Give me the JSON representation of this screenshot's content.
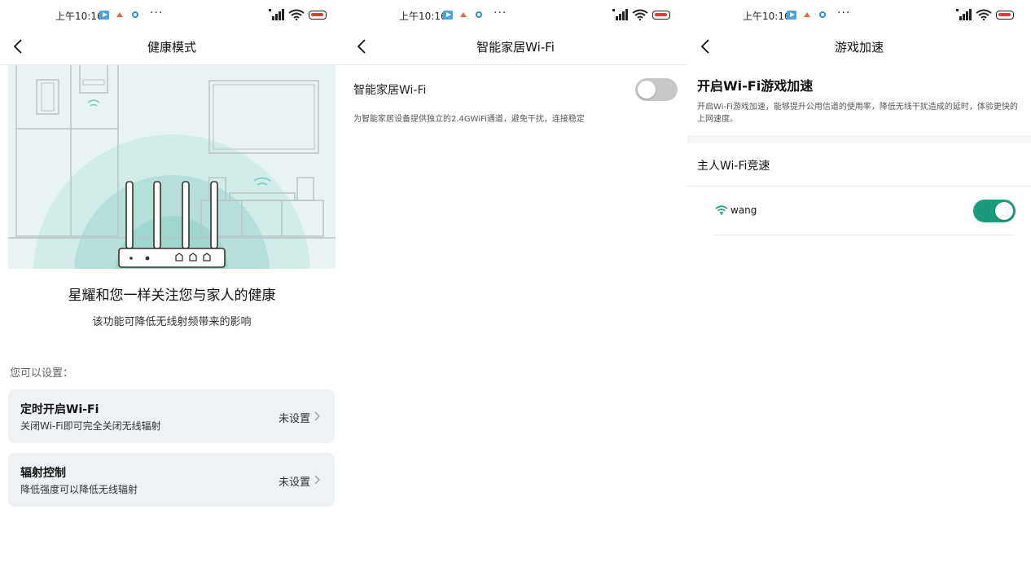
{
  "status_bar": {
    "time": "上午10:16",
    "dots": "···"
  },
  "screen1": {
    "title": "健康模式",
    "headline": "星耀和您一样关注您与家人的健康",
    "subline": "该功能可降低无线射频带来的影响",
    "section_label": "您可以设置：",
    "items": [
      {
        "title": "定时开启Wi-Fi",
        "subtitle": "关闭Wi-Fi即可完全关闭无线辐射",
        "value": "未设置"
      },
      {
        "title": "辐射控制",
        "subtitle": "降低强度可以降低无线辐射",
        "value": "未设置"
      }
    ]
  },
  "screen2": {
    "title": "智能家居Wi-Fi",
    "setting_title": "智能家居Wi-Fi",
    "setting_desc": "为智能家居设备提供独立的2.4GWiFi通道，避免干扰，连接稳定",
    "toggle_on": false
  },
  "screen3": {
    "title": "游戏加速",
    "heading": "开启Wi-Fi游戏加速",
    "desc": "开启Wi-Fi游戏加速，能够提升公用信道的使用率，降低无线干扰造成的延时，体验更快的上网速度。",
    "section": "主人Wi-Fi竞速",
    "network": {
      "name": "wang",
      "toggle_on": true
    }
  },
  "colors": {
    "accent": "#1a9b7e",
    "hero_bg": "#eaf3f3",
    "card_bg": "#eef2f5",
    "toggle_off": "#c8c8c8"
  }
}
